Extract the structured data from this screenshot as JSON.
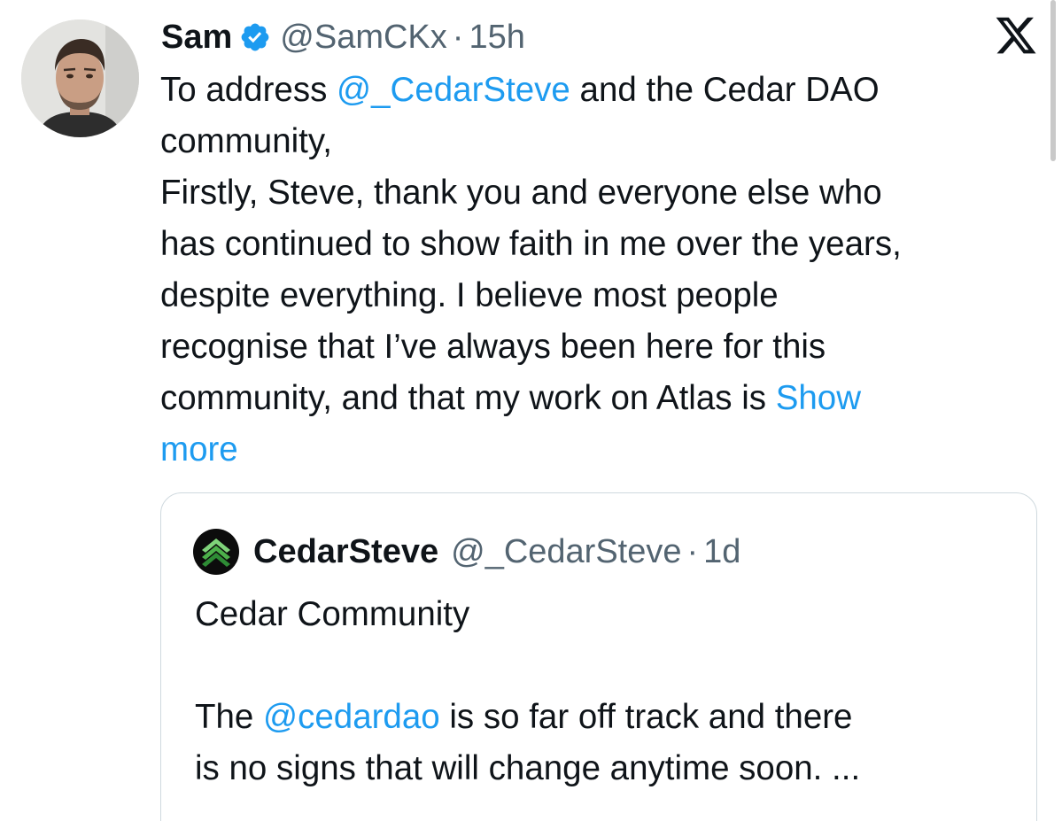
{
  "tweet": {
    "author": {
      "display_name": "Sam",
      "handle": "@SamCKx",
      "verified": true,
      "verified_icon": "verified-badge-icon",
      "verified_color": "#1d9bf0",
      "avatar_icon": "user-avatar"
    },
    "separator": "·",
    "time": "15h",
    "platform_icon": "x-logo-icon",
    "body": {
      "line1_a": "To address ",
      "line1_mention": "@_CedarSteve",
      "line1_b": " and the Cedar DAO",
      "line2": "community,",
      "line3": "Firstly, Steve, thank you and everyone else who",
      "line4": "has continued to show faith in me over the years,",
      "line5": "despite everything. I believe most people",
      "line6": "recognise that I’ve always been here for this",
      "line7_a": "community, and that my work on Atlas is ",
      "show_more_a": "Show",
      "show_more_b": "more"
    },
    "quoted_tweet": {
      "author": {
        "display_name": "CedarSteve",
        "handle": "@_CedarSteve",
        "avatar_icon": "cedar-logo-icon"
      },
      "separator": "·",
      "time": "1d",
      "body": {
        "line1": "Cedar Community",
        "line3_a": "The ",
        "line3_mention": "@cedardao",
        "line3_b": " is so far off track and there",
        "line4": "is no signs that will change anytime soon. ..."
      }
    }
  },
  "colors": {
    "link": "#1d9bf0",
    "secondary_text": "#536471",
    "primary_text": "#0f1419",
    "border": "#cfd9de"
  }
}
